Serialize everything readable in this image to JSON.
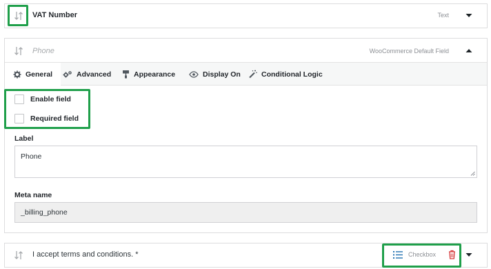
{
  "fields": [
    {
      "title": "VAT Number",
      "type": "Text"
    },
    {
      "title": "Phone",
      "type": "WooCommerce Default Field"
    },
    {
      "title": "I accept terms and conditions. *",
      "type": "Checkbox"
    }
  ],
  "tabs": [
    {
      "label": "General",
      "icon": "gear-icon"
    },
    {
      "label": "Advanced",
      "icon": "gears-icon"
    },
    {
      "label": "Appearance",
      "icon": "paint-roller-icon"
    },
    {
      "label": "Display On",
      "icon": "eye-icon"
    },
    {
      "label": "Conditional Logic",
      "icon": "magic-wand-icon"
    }
  ],
  "general": {
    "enable_field": "Enable field",
    "required_field": "Required field",
    "label_label": "Label",
    "label_value": "Phone",
    "meta_label": "Meta name",
    "meta_value": "_billing_phone"
  },
  "colors": {
    "highlight": "#1f9f4a",
    "delete": "#d63638",
    "list_icon": "#2271b1"
  }
}
